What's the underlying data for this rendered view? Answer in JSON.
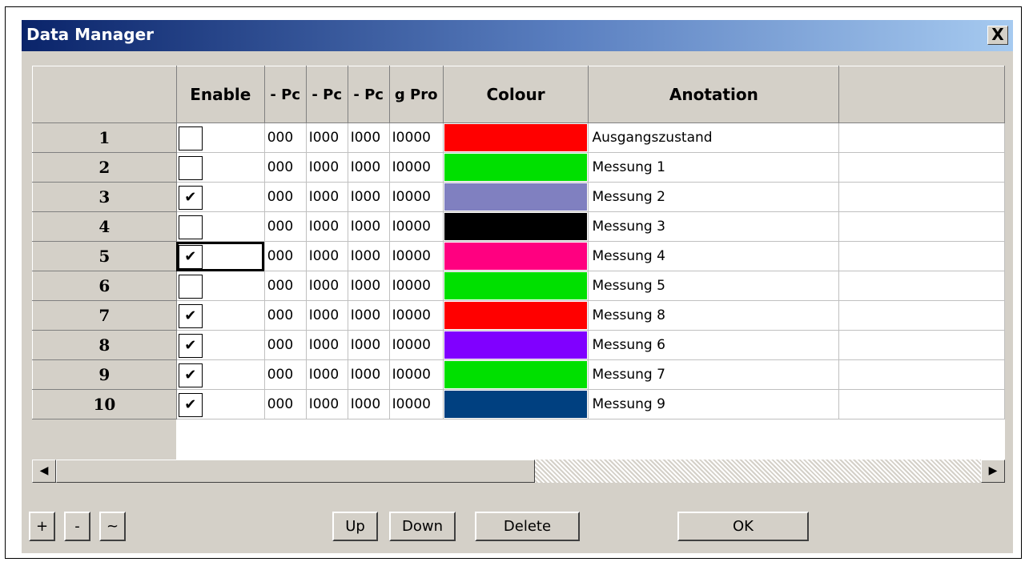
{
  "window": {
    "title": "Data Manager",
    "close_label": "X"
  },
  "grid": {
    "headers": [
      "",
      "Enable",
      "- Pc",
      "- Pc",
      "- Pc",
      "g Pro",
      "Colour",
      "Anotation",
      ""
    ],
    "rows": [
      {
        "index": "1",
        "enabled": false,
        "v1": "000",
        "v2": "I000",
        "v3": "I000",
        "v4": "I0000",
        "color": "#ff0000",
        "annotation": "Ausgangszustand"
      },
      {
        "index": "2",
        "enabled": false,
        "v1": "000",
        "v2": "I000",
        "v3": "I000",
        "v4": "I0000",
        "color": "#00e000",
        "annotation": "Messung 1"
      },
      {
        "index": "3",
        "enabled": true,
        "v1": "000",
        "v2": "I000",
        "v3": "I000",
        "v4": "I0000",
        "color": "#8080c0",
        "annotation": "Messung 2"
      },
      {
        "index": "4",
        "enabled": false,
        "v1": "000",
        "v2": "I000",
        "v3": "I000",
        "v4": "I0000",
        "color": "#000000",
        "annotation": "Messung 3"
      },
      {
        "index": "5",
        "enabled": true,
        "v1": "000",
        "v2": "I000",
        "v3": "I000",
        "v4": "I0000",
        "color": "#ff0080",
        "annotation": "Messung 4"
      },
      {
        "index": "6",
        "enabled": false,
        "v1": "000",
        "v2": "I000",
        "v3": "I000",
        "v4": "I0000",
        "color": "#00e000",
        "annotation": "Messung 5"
      },
      {
        "index": "7",
        "enabled": true,
        "v1": "000",
        "v2": "I000",
        "v3": "I000",
        "v4": "I0000",
        "color": "#ff0000",
        "annotation": "Messung 8"
      },
      {
        "index": "8",
        "enabled": true,
        "v1": "000",
        "v2": "I000",
        "v3": "I000",
        "v4": "I0000",
        "color": "#8000ff",
        "annotation": "Messung 6"
      },
      {
        "index": "9",
        "enabled": true,
        "v1": "000",
        "v2": "I000",
        "v3": "I000",
        "v4": "I0000",
        "color": "#00e000",
        "annotation": "Messung 7"
      },
      {
        "index": "10",
        "enabled": true,
        "v1": "000",
        "v2": "I000",
        "v3": "I000",
        "v4": "I0000",
        "color": "#004080",
        "annotation": "Messung 9"
      }
    ]
  },
  "scrollbar": {
    "left_icon": "arrow-left-icon",
    "right_icon": "arrow-right-icon",
    "left_glyph": "◀",
    "right_glyph": "▶"
  },
  "buttons": {
    "add": "+",
    "remove": "-",
    "tilde": "~",
    "up": "Up",
    "down": "Down",
    "delete": "Delete",
    "ok": "OK"
  },
  "check_glyph": "✔"
}
